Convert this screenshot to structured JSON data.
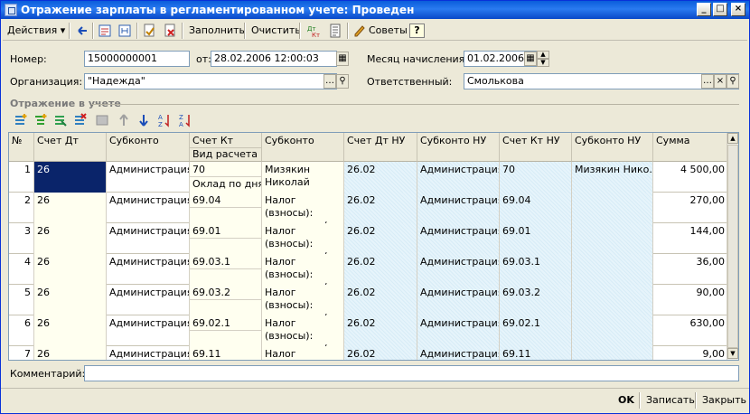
{
  "window": {
    "title": "Отражение зарплаты в регламентированном учете: Проведен",
    "controls": [
      "minimize",
      "maximize",
      "close"
    ]
  },
  "toolbar": {
    "actions_label": "Действия",
    "fill_label": "Заполнить",
    "clear_label": "Очистить",
    "tips_label": "Советы",
    "help_label": "?"
  },
  "header": {
    "number_label": "Номер:",
    "number_value": "15000000001",
    "from_label": "от:",
    "from_value": "28.02.2006 12:00:03",
    "month_label": "Месяц начисления:",
    "month_value": "01.02.2006",
    "org_label": "Организация:",
    "org_value": "\"Надежда\"",
    "responsible_label": "Ответственный:",
    "responsible_value": "Смолькова"
  },
  "section_title": "Отражение в учете",
  "table": {
    "columns": {
      "num": "№",
      "debit": "Счет Дт",
      "subconto": "Субконто",
      "credit": "Счет Кт",
      "calc_type": "Вид расчета",
      "subconto2": "Субконто",
      "debit_nu": "Счет Дт НУ",
      "subconto_nu": "Субконто НУ",
      "credit_nu": "Счет Кт НУ",
      "subconto_nu2": "Субконто НУ",
      "sum": "Сумма"
    },
    "rows": [
      {
        "n": "1",
        "debit": "26",
        "sub": "Администрация",
        "credit": "70",
        "calc": "Оклад по дням",
        "sub2": "Мизякин Николай",
        "debit_nu": "26.02",
        "sub_nu": "Администрация",
        "credit_nu": "70",
        "sub_nu2": "Мизякин Нико...",
        "sum": "4 500,00"
      },
      {
        "n": "2",
        "debit": "26",
        "sub": "Администрация",
        "credit": "69.04",
        "calc": "",
        "sub2": "Налог (взносы): начислено /",
        "debit_nu": "26.02",
        "sub_nu": "Администрация",
        "credit_nu": "69.04",
        "sub_nu2": "",
        "sum": "270,00"
      },
      {
        "n": "3",
        "debit": "26",
        "sub": "Администрация",
        "credit": "69.01",
        "calc": "",
        "sub2": "Налог (взносы): начислено /",
        "debit_nu": "26.02",
        "sub_nu": "Администрация",
        "credit_nu": "69.01",
        "sub_nu2": "",
        "sum": "144,00"
      },
      {
        "n": "4",
        "debit": "26",
        "sub": "Администрация",
        "credit": "69.03.1",
        "calc": "",
        "sub2": "Налог (взносы): начислено /",
        "debit_nu": "26.02",
        "sub_nu": "Администрация",
        "credit_nu": "69.03.1",
        "sub_nu2": "",
        "sum": "36,00"
      },
      {
        "n": "5",
        "debit": "26",
        "sub": "Администрация",
        "credit": "69.03.2",
        "calc": "",
        "sub2": "Налог (взносы): начислено /",
        "debit_nu": "26.02",
        "sub_nu": "Администрация",
        "credit_nu": "69.03.2",
        "sub_nu2": "",
        "sum": "90,00"
      },
      {
        "n": "6",
        "debit": "26",
        "sub": "Администрация",
        "credit": "69.02.1",
        "calc": "",
        "sub2": "Налог (взносы): начислено /",
        "debit_nu": "26.02",
        "sub_nu": "Администрация",
        "credit_nu": "69.02.1",
        "sub_nu2": "",
        "sum": "630,00"
      },
      {
        "n": "7",
        "debit": "26",
        "sub": "Администрация",
        "credit": "69.11",
        "calc": "",
        "sub2": "Налог (взносы): начислено /",
        "debit_nu": "26.02",
        "sub_nu": "Администрация",
        "credit_nu": "69.11",
        "sub_nu2": "",
        "sum": "9,00"
      }
    ]
  },
  "comment_label": "Комментарий:",
  "comment_value": "",
  "footer": {
    "ok_label": "OK",
    "save_label": "Записать",
    "close_label": "Закрыть"
  },
  "colors": {
    "title_bar": "#0a5ddb",
    "window_bg": "#ece9d8",
    "selection": "#0a246a",
    "yellow_cell": "#fffff0",
    "blue_cell": "#e6f4fb"
  }
}
